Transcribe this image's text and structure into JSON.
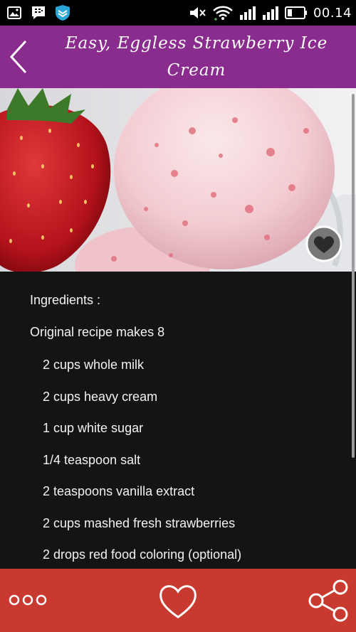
{
  "status_bar": {
    "time": "00.14",
    "icons": [
      "gallery-icon",
      "bbm-icon",
      "shield-icon",
      "mute-icon",
      "wifi-icon",
      "signal-icon",
      "signal-icon-2",
      "battery-icon"
    ]
  },
  "app_bar": {
    "title": "Easy, Eggless Strawberry Ice Cream",
    "back_icon": "chevron-left-icon",
    "color": "#8a2b8e"
  },
  "hero": {
    "image": "strawberry ice cream photo",
    "favorite_icon": "heart-icon"
  },
  "recipe": {
    "ingredients_heading": "Ingredients :",
    "makes": "Original recipe makes 8",
    "ingredients": [
      "2 cups whole milk",
      "2 cups heavy cream",
      "1 cup white sugar",
      "1/4 teaspoon salt",
      "2 teaspoons vanilla extract",
      "2 cups mashed fresh strawberries",
      "2 drops red food coloring (optional)"
    ]
  },
  "bottom_bar": {
    "color": "#c8392f",
    "more_icon": "more-dots-icon",
    "like_icon": "heart-outline-icon",
    "share_icon": "share-icon"
  }
}
